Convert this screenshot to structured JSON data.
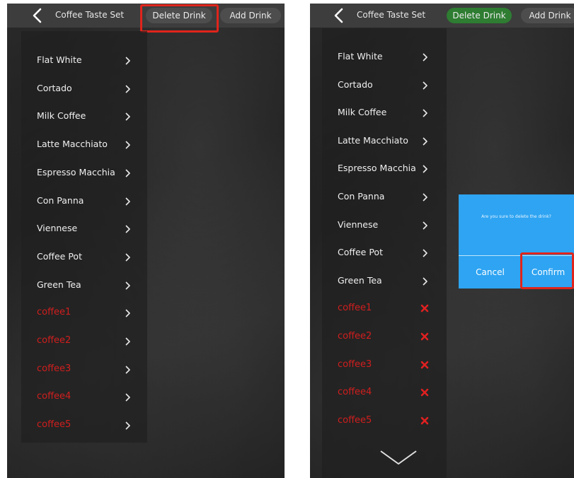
{
  "left": {
    "header": {
      "title": "Coffee Taste Set",
      "delete_label": "Delete Drink",
      "add_label": "Add Drink"
    },
    "items": [
      {
        "label": "Flat White"
      },
      {
        "label": "Cortado"
      },
      {
        "label": "Milk Coffee"
      },
      {
        "label": "Latte Macchiato"
      },
      {
        "label": "Espresso Macchia"
      },
      {
        "label": "Con Panna"
      },
      {
        "label": "Viennese"
      },
      {
        "label": "Coffee Pot"
      },
      {
        "label": "Green Tea"
      },
      {
        "label": "coffee1"
      },
      {
        "label": "coffee2"
      },
      {
        "label": "coffee3"
      },
      {
        "label": "coffee4"
      },
      {
        "label": "coffee5"
      }
    ]
  },
  "right": {
    "header": {
      "title": "Coffee Taste Set",
      "delete_label": "Delete Drink",
      "add_label": "Add Drink"
    },
    "items": [
      {
        "label": "Flat White"
      },
      {
        "label": "Cortado"
      },
      {
        "label": "Milk Coffee"
      },
      {
        "label": "Latte Macchiato"
      },
      {
        "label": "Espresso Macchia"
      },
      {
        "label": "Con Panna"
      },
      {
        "label": "Viennese"
      },
      {
        "label": "Coffee Pot"
      },
      {
        "label": "Green Tea"
      },
      {
        "label": "coffee1"
      },
      {
        "label": "coffee2"
      },
      {
        "label": "coffee3"
      },
      {
        "label": "coffee4"
      },
      {
        "label": "coffee5"
      }
    ],
    "dialog": {
      "message": "Are you sure to delete the drink?",
      "cancel_label": "Cancel",
      "confirm_label": "Confirm"
    }
  },
  "icons": {
    "back": "chevron-left-icon",
    "row": "chevron-right-icon",
    "delete": "close-icon",
    "scroll": "chevron-down-icon"
  },
  "colors": {
    "custom_drink_text": "#d11e1e",
    "delete_active_button": "#2e7d32",
    "dialog_background": "#2ea4f2",
    "highlight_border": "#e0241b"
  }
}
